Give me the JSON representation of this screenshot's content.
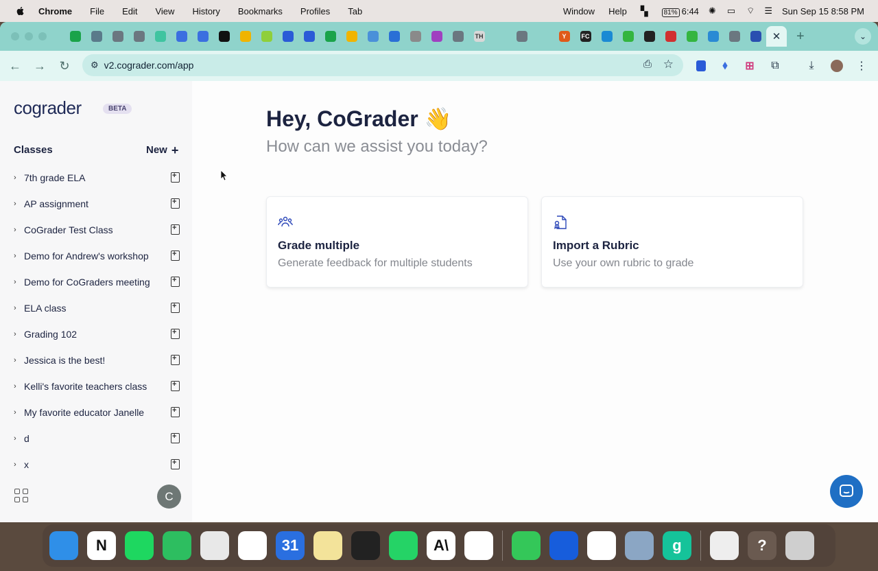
{
  "menubar": {
    "app": "Chrome",
    "items": [
      "File",
      "Edit",
      "View",
      "History",
      "Bookmarks",
      "Profiles",
      "Tab"
    ],
    "right_items": [
      "Window",
      "Help"
    ],
    "battery": "81%",
    "time_remaining": "6:44",
    "datetime": "Sun Sep 15  8:58 PM"
  },
  "browser": {
    "tab_colors": [
      "#1aa34a",
      "#5a7a8a",
      "#6b7780",
      "#6b7780",
      "#3fc4a0",
      "#3b6fe0",
      "#3b6fe0",
      "#111111",
      "#f0b400",
      "#8fcf3a",
      "#2a5bd7",
      "#2a5bd7",
      "#1aa34a",
      "#f0b400",
      "#4a90d9",
      "#2a6fd6",
      "#8a8a8a",
      "#a040c0",
      "#6b7780",
      "#d8d8d8",
      "#8fd3cb",
      "#6b7780",
      "#8fd3cb",
      "#e05a1a",
      "#222222",
      "#1a8ad4",
      "#34b540",
      "#222222",
      "#d03030",
      "#34b540",
      "#2a8ad4",
      "#6b7780",
      "#2a4fb0"
    ],
    "tab_th": "TH",
    "tab_fc": "FC",
    "tab_y": "Y",
    "url": "v2.cograder.com/app"
  },
  "app": {
    "logo": "cograder",
    "beta": "BETA",
    "classes_heading": "Classes",
    "new_label": "New",
    "classes": [
      {
        "name": "7th grade ELA"
      },
      {
        "name": "AP assignment"
      },
      {
        "name": "CoGrader Test Class"
      },
      {
        "name": "Demo for Andrew's workshop"
      },
      {
        "name": "Demo for CoGraders meeting"
      },
      {
        "name": "ELA class"
      },
      {
        "name": "Grading 102"
      },
      {
        "name": "Jessica is the best!"
      },
      {
        "name": "Kelli's favorite teachers class"
      },
      {
        "name": "My favorite educator Janelle"
      },
      {
        "name": "d"
      },
      {
        "name": "x"
      }
    ],
    "avatar_initial": "C",
    "greeting": "Hey, CoGrader 👋",
    "subtitle": "How can we assist you today?",
    "cards": [
      {
        "title": "Grade multiple",
        "desc": "Generate feedback for multiple students",
        "icon": "users-icon"
      },
      {
        "title": "Import a Rubric",
        "desc": "Use your own rubric to grade",
        "icon": "rubric-icon"
      }
    ]
  },
  "dock": {
    "apps": [
      {
        "name": "finder-icon",
        "color": "#2f8fe8",
        "glyph": ""
      },
      {
        "name": "notion-icon",
        "color": "#ffffff",
        "glyph": "N"
      },
      {
        "name": "spotify-icon",
        "color": "#1ed760",
        "glyph": ""
      },
      {
        "name": "evernote-icon",
        "color": "#2dbe60",
        "glyph": ""
      },
      {
        "name": "chrome-icon",
        "color": "#e8e8e8",
        "glyph": ""
      },
      {
        "name": "slack-icon",
        "color": "#ffffff",
        "glyph": ""
      },
      {
        "name": "calendar-icon",
        "color": "#2a6fe0",
        "glyph": "31"
      },
      {
        "name": "notes-icon",
        "color": "#f3e39a",
        "glyph": ""
      },
      {
        "name": "layers-icon",
        "color": "#222222",
        "glyph": ""
      },
      {
        "name": "whatsapp-icon",
        "color": "#25d366",
        "glyph": ""
      },
      {
        "name": "anthropic-icon",
        "color": "#ffffff",
        "glyph": "A\\"
      },
      {
        "name": "chatgpt-icon",
        "color": "#ffffff",
        "glyph": ""
      },
      {
        "name": "messages-icon",
        "color": "#34c759",
        "glyph": ""
      },
      {
        "name": "bitwarden-icon",
        "color": "#175ddc",
        "glyph": ""
      },
      {
        "name": "stack-icon",
        "color": "#ffffff",
        "glyph": ""
      },
      {
        "name": "preview-icon",
        "color": "#8ba6c4",
        "glyph": ""
      },
      {
        "name": "grammarly-icon",
        "color": "#15c39a",
        "glyph": "g"
      },
      {
        "name": "document-icon",
        "color": "#eeeeee",
        "glyph": ""
      },
      {
        "name": "help-icon",
        "color": "#6a5a50",
        "glyph": "?"
      },
      {
        "name": "trash-icon",
        "color": "#cfcfcf",
        "glyph": ""
      }
    ]
  }
}
